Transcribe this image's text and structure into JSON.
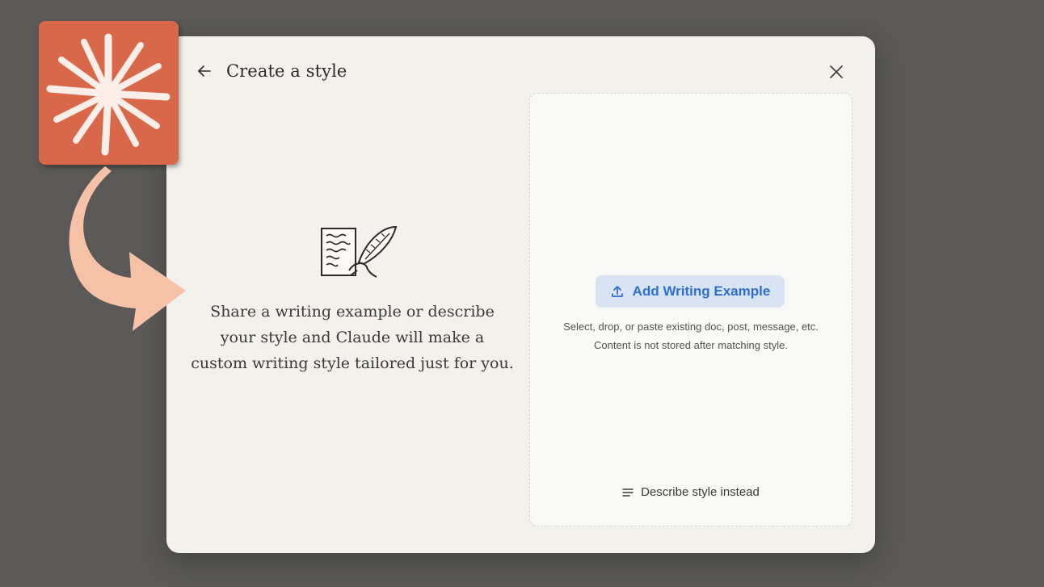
{
  "modal": {
    "title": "Create a style",
    "intro_text": "Share a writing example or describe your style and Claude will make a custom writing style tailored just for you.",
    "add_button_label": "Add Writing Example",
    "hint_line1": "Select, drop, or paste existing doc, post, message, etc.",
    "hint_line2": "Content is not stored after matching style.",
    "describe_label": "Describe style instead"
  },
  "icons": {
    "back": "arrow-left-icon",
    "close": "close-icon",
    "upload": "upload-icon",
    "lines": "text-lines-icon",
    "illustration": "quill-letter-illustration",
    "logo": "claude-starburst-logo",
    "arrow": "curved-arrow-pointer"
  },
  "colors": {
    "background": "#5a5957",
    "modal": "#f3f1ec",
    "accent_blue": "#2c6fd1",
    "button_bg": "#d8e3f3",
    "logo_orange": "#d9674a",
    "arrow_peach": "#f5c2a8"
  }
}
